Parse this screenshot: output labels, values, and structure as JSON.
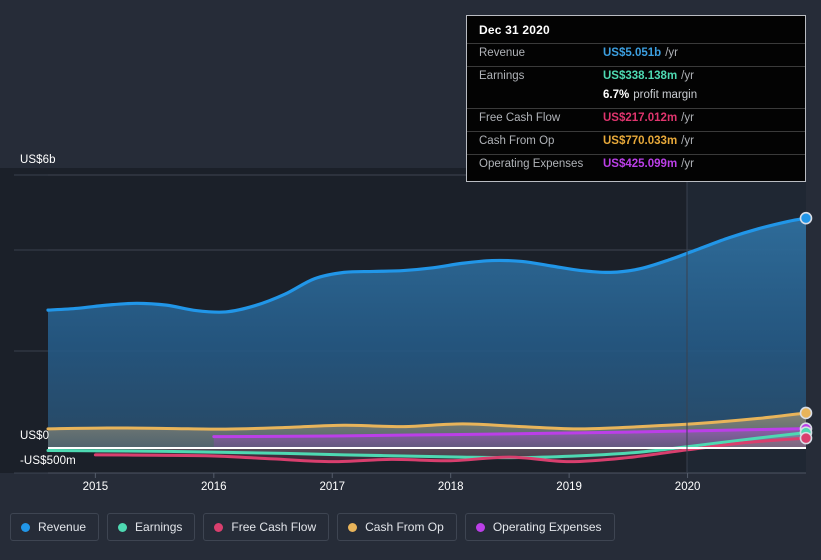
{
  "chart_data": {
    "type": "area",
    "title": "",
    "xlabel": "",
    "ylabel": "",
    "currency": "USD",
    "grid": true,
    "legend_position": "bottom",
    "y_axis": {
      "labels": [
        "US$6b",
        "US$0",
        "-US$500m"
      ],
      "max_label": "US$6b",
      "zero_label": "US$0",
      "min_label": "-US$500m",
      "ylim": [
        -500000000,
        6000000000
      ],
      "gridline_values": [
        6000000000,
        4500000000,
        2500000000,
        0,
        -500000000
      ]
    },
    "x_axis": {
      "tick_labels": [
        "2015",
        "2016",
        "2017",
        "2018",
        "2019",
        "2020"
      ],
      "tick_values": [
        2015,
        2016,
        2017,
        2018,
        2019,
        2020
      ]
    },
    "forecast_divider_label": "2020",
    "series": [
      {
        "name": "Revenue",
        "color": "#2196e8",
        "unit": "US$",
        "x": [
          2014.6,
          2014.85,
          2015.1,
          2015.35,
          2015.6,
          2015.85,
          2016.1,
          2016.35,
          2016.6,
          2016.85,
          2017.1,
          2017.35,
          2017.6,
          2017.85,
          2018.1,
          2018.35,
          2018.6,
          2018.85,
          2019.1,
          2019.35,
          2019.6,
          2019.85,
          2020.1,
          2020.35,
          2020.6,
          2020.85,
          2021.0
        ],
        "values": [
          3.03,
          3.07,
          3.14,
          3.18,
          3.14,
          3.02,
          2.99,
          3.13,
          3.38,
          3.72,
          3.86,
          3.88,
          3.9,
          3.96,
          4.06,
          4.12,
          4.1,
          4.0,
          3.9,
          3.86,
          3.94,
          4.14,
          4.38,
          4.62,
          4.82,
          4.98,
          5.051
        ],
        "value_unit": "billions",
        "end_value_label": "US$5.051b"
      },
      {
        "name": "Earnings",
        "color": "#4ed9b2",
        "unit": "US$",
        "x": [
          2014.6,
          2015.1,
          2015.6,
          2016.1,
          2016.6,
          2017.1,
          2017.6,
          2018.1,
          2018.6,
          2019.1,
          2019.6,
          2020.1,
          2020.6,
          2021.0
        ],
        "values": [
          -55,
          -62,
          -74,
          -95,
          -118,
          -150,
          -175,
          -200,
          -210,
          -170,
          -90,
          60,
          220,
          338.138
        ],
        "value_unit": "millions",
        "end_value_label": "US$338.138m"
      },
      {
        "name": "Free Cash Flow",
        "color": "#d93f6e",
        "unit": "US$",
        "x": [
          2015.0,
          2015.5,
          2016.0,
          2016.5,
          2017.0,
          2017.5,
          2018.0,
          2018.5,
          2019.0,
          2019.5,
          2020.0,
          2020.5,
          2021.0
        ],
        "values": [
          -150,
          -160,
          -175,
          -240,
          -300,
          -250,
          -280,
          -200,
          -300,
          -210,
          -40,
          120,
          217.012
        ],
        "value_unit": "millions",
        "end_value_label": "US$217.012m"
      },
      {
        "name": "Cash From Op",
        "color": "#e8b45a",
        "unit": "US$",
        "x": [
          2014.6,
          2015.1,
          2015.6,
          2016.1,
          2016.6,
          2017.1,
          2017.6,
          2018.1,
          2018.6,
          2019.1,
          2019.6,
          2020.1,
          2020.6,
          2021.0
        ],
        "values": [
          420,
          440,
          430,
          415,
          450,
          500,
          470,
          530,
          470,
          420,
          470,
          540,
          650,
          770.033
        ],
        "value_unit": "millions",
        "end_value_label": "US$770.033m"
      },
      {
        "name": "Operating Expenses",
        "color": "#bb3fe8",
        "unit": "US$",
        "x": [
          2016.0,
          2016.5,
          2017.0,
          2017.5,
          2018.0,
          2018.5,
          2019.0,
          2019.5,
          2020.0,
          2020.5,
          2021.0
        ],
        "values": [
          250,
          255,
          265,
          280,
          295,
          310,
          330,
          350,
          375,
          400,
          425.099
        ],
        "value_unit": "millions",
        "end_value_label": "US$425.099m"
      }
    ]
  },
  "tooltip": {
    "title": "Dec 31 2020",
    "rows": [
      {
        "label": "Revenue",
        "value": "US$5.051b",
        "unit": "/yr",
        "color": "#3c9fe0"
      },
      {
        "label": "Earnings",
        "value": "US$338.138m",
        "unit": "/yr",
        "color": "#4ed9b2"
      },
      {
        "label": "",
        "value": "6.7%",
        "unit": "profit margin",
        "color": "#ffffff"
      },
      {
        "label": "Free Cash Flow",
        "value": "US$217.012m",
        "unit": "/yr",
        "color": "#e0356e"
      },
      {
        "label": "Cash From Op",
        "value": "US$770.033m",
        "unit": "/yr",
        "color": "#e8a93a"
      },
      {
        "label": "Operating Expenses",
        "value": "US$425.099m",
        "unit": "/yr",
        "color": "#bb3fe8"
      }
    ]
  },
  "legend": {
    "items": [
      {
        "label": "Revenue",
        "color": "#2196e8"
      },
      {
        "label": "Earnings",
        "color": "#4ed9b2"
      },
      {
        "label": "Free Cash Flow",
        "color": "#d93f6e"
      },
      {
        "label": "Cash From Op",
        "color": "#e8b45a"
      },
      {
        "label": "Operating Expenses",
        "color": "#bb3fe8"
      }
    ]
  },
  "axis": {
    "y_top": "US$6b",
    "y_zero": "US$0",
    "y_min": "-US$500m",
    "x_ticks": [
      "2015",
      "2016",
      "2017",
      "2018",
      "2019",
      "2020"
    ]
  }
}
